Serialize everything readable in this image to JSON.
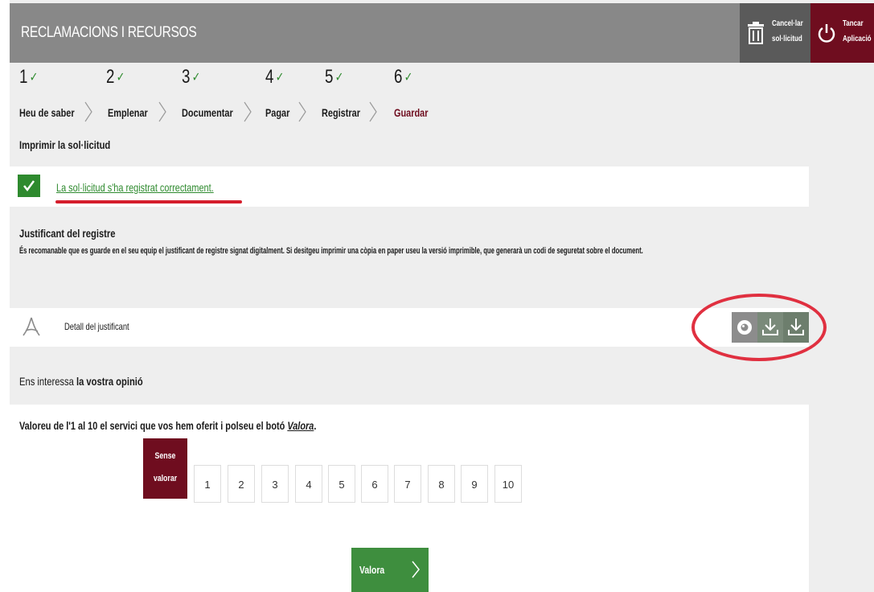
{
  "header": {
    "title": "RECLAMACIONS I RECURSOS",
    "cancel_line1": "Cancel·lar",
    "cancel_line2": "sol·licitud",
    "close_line1": "Tancar",
    "close_line2": "Aplicació"
  },
  "steps": [
    {
      "num": "1",
      "label": "Heu de saber",
      "done": true
    },
    {
      "num": "2",
      "label": "Emplenar",
      "done": true
    },
    {
      "num": "3",
      "label": "Documentar",
      "done": true
    },
    {
      "num": "4",
      "label": "Pagar",
      "done": true
    },
    {
      "num": "5",
      "label": "Registrar",
      "done": true
    },
    {
      "num": "6",
      "label": "Guardar",
      "done": true,
      "active": true
    }
  ],
  "checkmark": "✓",
  "section_title": "Imprimir la sol·licitud",
  "alert": {
    "text": "La sol·licitud s'ha registrat correctament."
  },
  "justificant": {
    "title": "Justificant del registre",
    "text": "És recomanable que es guarde en el seu equip el justificant de registre signat digitalment. Si desitgeu imprimir una còpia en paper useu la versió imprimible, que generarà un codi de seguretat sobre el document."
  },
  "document": {
    "label": "Detall del justificant"
  },
  "opinion": {
    "title_prefix": "Ens interessa ",
    "title_bold": "la vostra opinió",
    "instruction_prefix": "Valoreu de l'1 al 10 el servici que vos hem oferit i polseu el botó ",
    "instruction_link": "Valora",
    "instruction_suffix": ".",
    "no_rating_line1": "Sense",
    "no_rating_line2": "valorar",
    "scores": [
      "1",
      "2",
      "3",
      "4",
      "5",
      "6",
      "7",
      "8",
      "9",
      "10"
    ],
    "submit_label": "Valora"
  },
  "colors": {
    "header_bg": "#888888",
    "cancel_bg": "#5a5a5a",
    "accent_maroon": "#6f0d1f",
    "success_green": "#2e8a2e",
    "highlight_red": "#e03040"
  },
  "icons": [
    "trash-icon",
    "power-icon",
    "check-icon",
    "pdf-icon",
    "eye-icon",
    "download-icon",
    "chevron-right-icon"
  ]
}
